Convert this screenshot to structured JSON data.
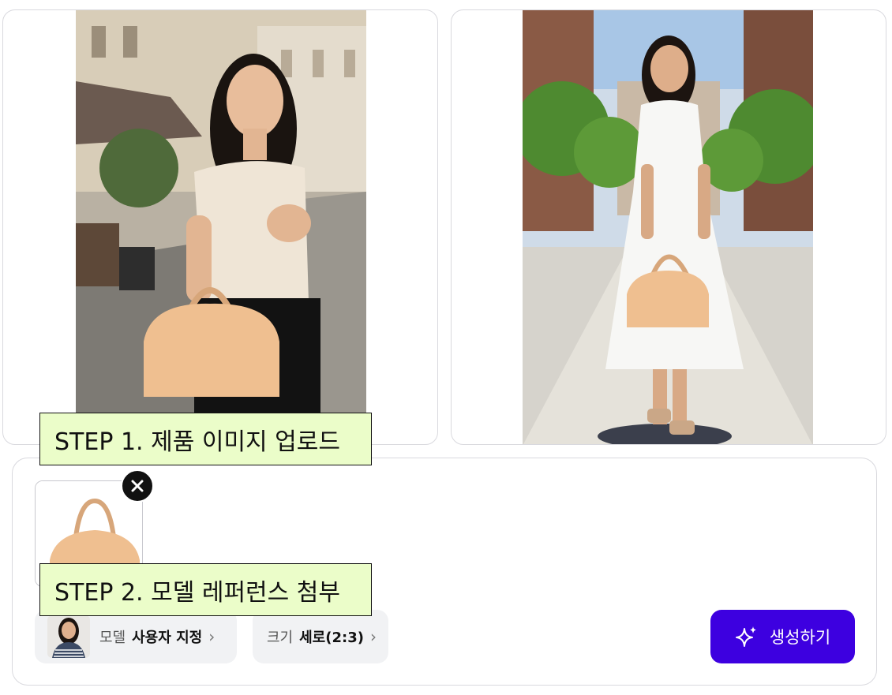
{
  "results": [
    {
      "alt": "woman in beige knit top with tan handbag on cobblestone street"
    },
    {
      "alt": "woman in white dress with tan handbag on sunny street"
    }
  ],
  "composer": {
    "uploaded_product": "tan handbag",
    "remove_icon": "close-icon",
    "model_chip": {
      "key": "모델",
      "value": "사용자 지정",
      "chevron": "chevron-right-icon"
    },
    "size_chip": {
      "key": "크기",
      "value": "세로(2:3)",
      "chevron": "chevron-right-icon"
    },
    "generate_button": {
      "label": "생성하기",
      "icon": "sparkles-icon",
      "color": "#3d00e0"
    }
  },
  "annotations": {
    "step1": "STEP 1. 제품 이미지 업로드",
    "step2": "STEP 2. 모델 레퍼런스 첨부",
    "background": "#ebfdc9"
  }
}
